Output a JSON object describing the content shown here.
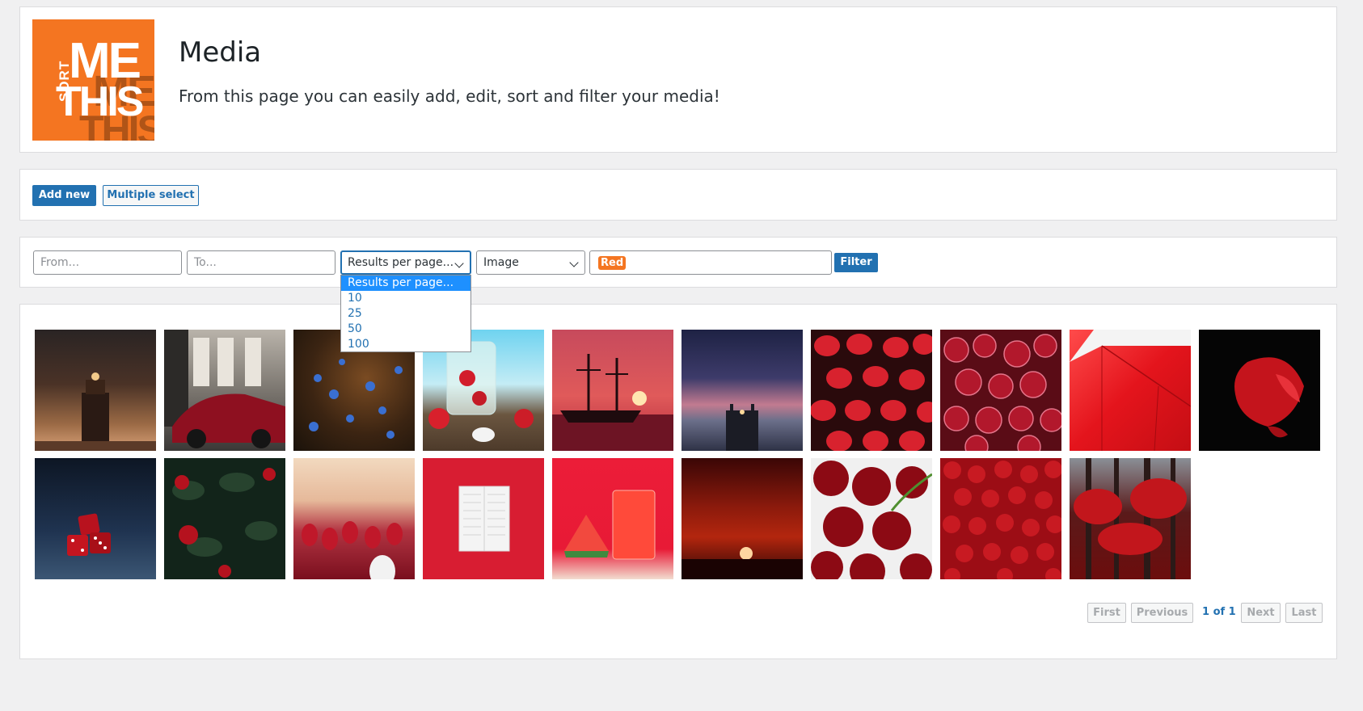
{
  "header": {
    "logo_words": {
      "sort": "SORT",
      "me": "ME",
      "this": "THIS"
    },
    "title": "Media",
    "description": "From this page you can easily add, edit, sort and filter your media!"
  },
  "actions": {
    "add_new": "Add new",
    "multiple_select": "Multiple select"
  },
  "filter": {
    "from_placeholder": "From...",
    "to_placeholder": "To...",
    "results_per_page": "Results per page...",
    "type_select": "Image",
    "tag": "Red",
    "filter_button": "Filter",
    "dropdown_options": [
      "Results per page...",
      "10",
      "25",
      "50",
      "100"
    ],
    "dropdown_selected": "Results per page..."
  },
  "gallery": {
    "images": [
      "lighthouse-icon",
      "red-car-icon",
      "blue-flowers-icon",
      "strawberry-drink-icon",
      "pirate-ship-sunset-icon",
      "pier-dusk-icon",
      "red-lanterns-icon",
      "pomegranate-icon",
      "red-wall-icon",
      "betta-fish-icon",
      "red-dice-icon",
      "red-roses-bush-icon",
      "red-tulips-icon",
      "white-shutter-icon",
      "watermelon-juice-icon",
      "red-sunset-icon",
      "cherries-icon",
      "rose-field-icon",
      "red-forest-icon"
    ]
  },
  "pagination": {
    "first": "First",
    "previous": "Previous",
    "status": "1 of 1",
    "next": "Next",
    "last": "Last"
  },
  "colors": {
    "accent": "#2271b1",
    "brand": "#f47521",
    "page_bg": "#f0f0f1"
  }
}
